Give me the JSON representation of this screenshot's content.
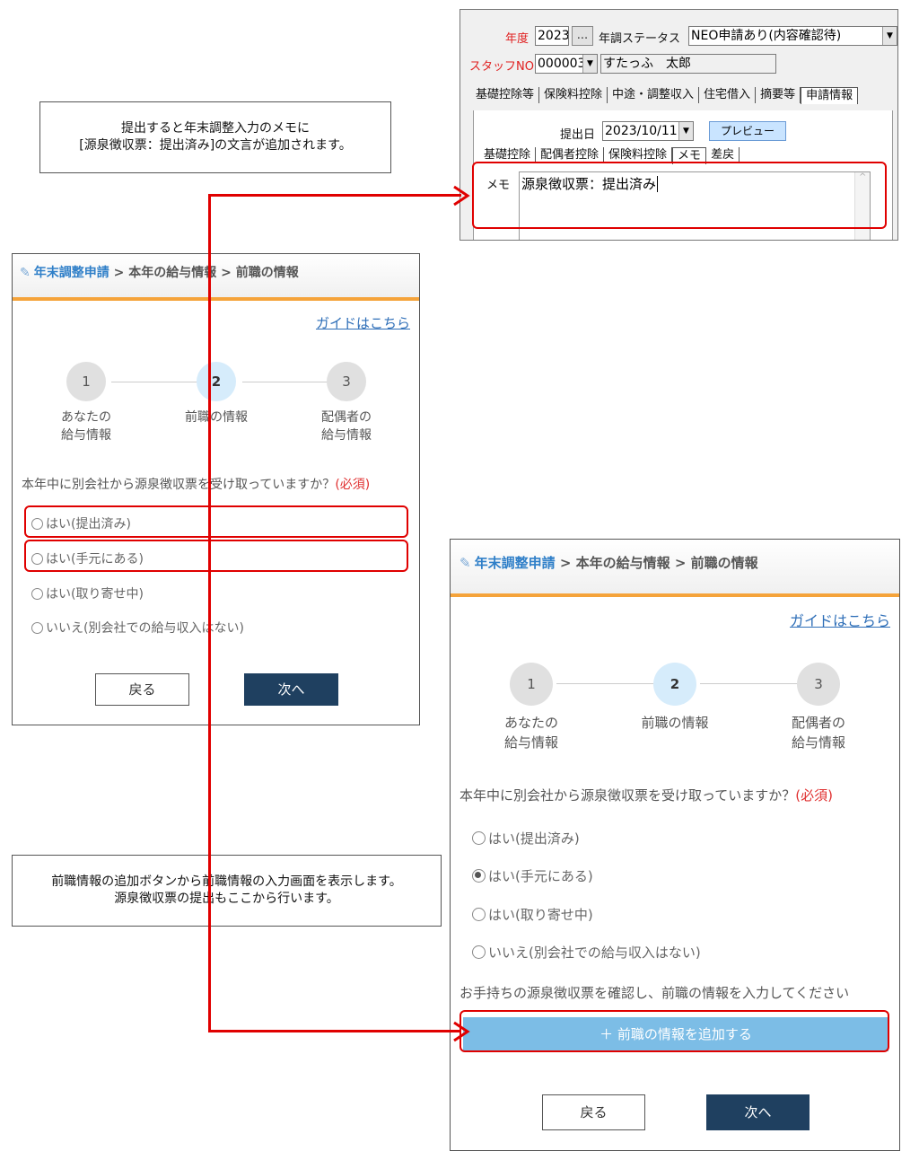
{
  "note_top": {
    "line1": "提出すると年末調整入力のメモに",
    "line2": "[源泉徴収票：提出済み]の文言が追加されます。"
  },
  "note_bottom": {
    "line1": "前職情報の追加ボタンから前職情報の入力画面を表示します。",
    "line2": "源泉徴収票の提出もここから行います。"
  },
  "app": {
    "year_label": "年度",
    "year_value": "2023",
    "ellipsis_button": "...",
    "status_label": "年調ステータス",
    "status_value": "NEO申請あり(内容確認待)",
    "staff_label": "スタッフNO",
    "staff_no": "000003",
    "staff_name": "すたっふ　太郎",
    "tabs": [
      "基礎控除等",
      "保険料控除",
      "中途・調整収入",
      "住宅借入",
      "摘要等",
      "申請情報"
    ],
    "submit_date_label": "提出日",
    "submit_date_value": "2023/10/11",
    "preview_button": "プレビュー",
    "subtabs": [
      "基礎控除",
      "配偶者控除",
      "保険料控除",
      "メモ",
      "差戻"
    ],
    "memo_label": "メモ",
    "memo_value": "源泉徴収票：提出済み"
  },
  "form": {
    "breadcrumb_first": "年末調整申請",
    "breadcrumb_rest": " > 本年の給与情報 > 前職の情報",
    "guide_link": "ガイドはこちら",
    "steps": [
      {
        "num": "1",
        "line1": "あなたの",
        "line2": "給与情報"
      },
      {
        "num": "2",
        "line1": "前職の情報",
        "line2": ""
      },
      {
        "num": "3",
        "line1": "配偶者の",
        "line2": "給与情報"
      }
    ],
    "question": "本年中に別会社から源泉徴収票を受け取っていますか？",
    "required": "(必須)",
    "options": [
      "はい(提出済み)",
      "はい(手元にある)",
      "はい(取り寄せ中)",
      "いいえ(別会社での給与収入はない)"
    ],
    "back_button": "戻る",
    "next_button": "次へ",
    "info_text": "お手持ちの源泉徴収票を確認し、前職の情報を入力してください",
    "add_button": "＋ 前職の情報を追加する"
  }
}
